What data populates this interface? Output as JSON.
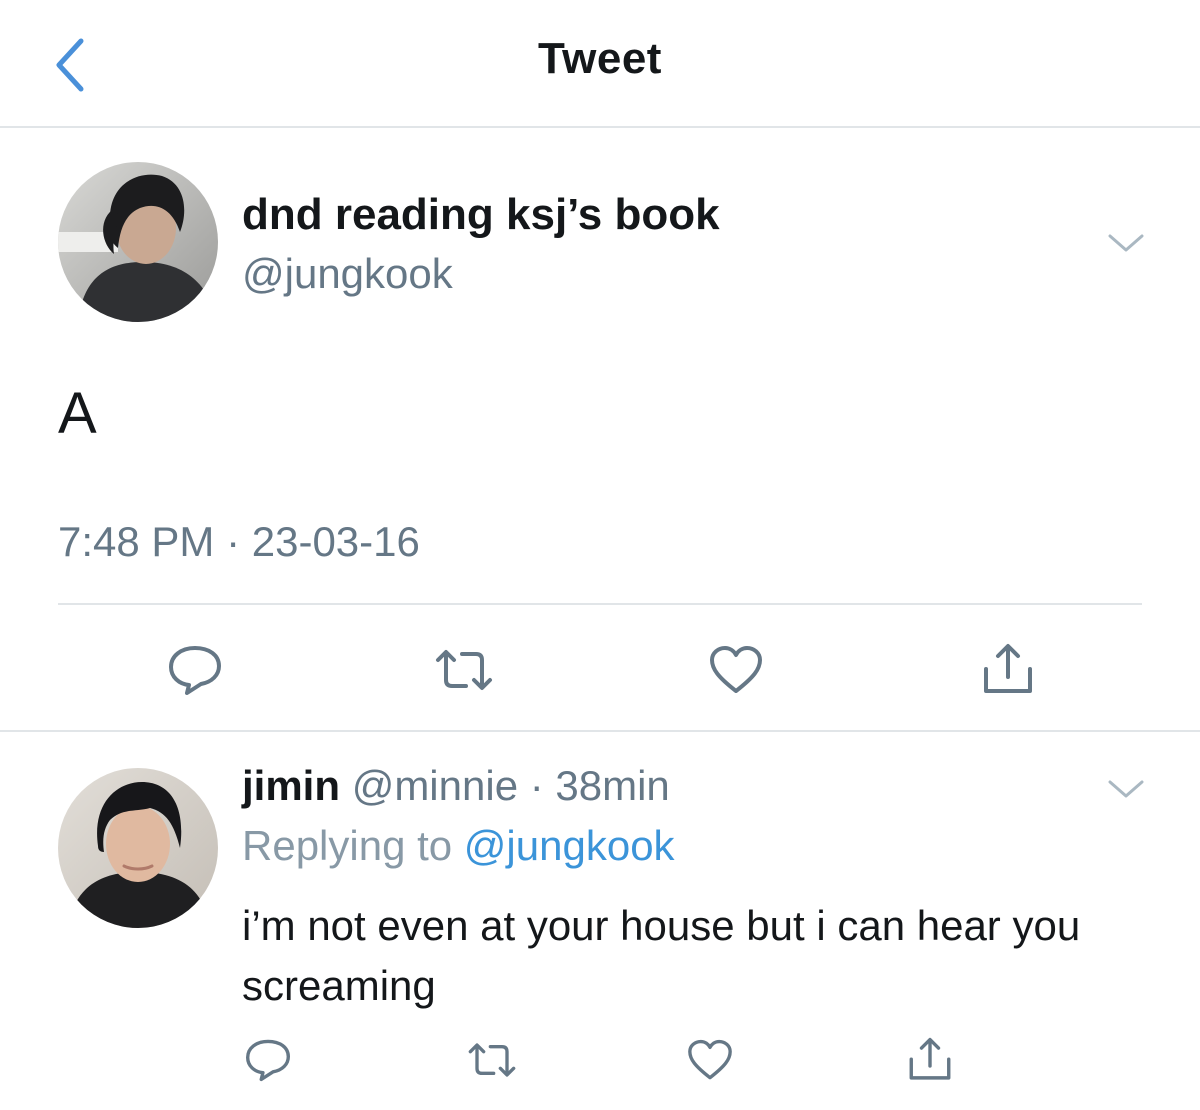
{
  "header": {
    "title": "Tweet"
  },
  "tweet": {
    "display_name": "dnd reading ksj’s book",
    "handle": "@jungkook",
    "text": "A",
    "timestamp": "7:48 PM · 23-03-16"
  },
  "reply": {
    "display_name": "jimin",
    "meta": "@minnie · 38min",
    "replying_prefix": "Replying to ",
    "replying_to": "@jungkook",
    "text": "i’m not even at your house but i can hear you screaming"
  },
  "colors": {
    "accent": "#4a90d9",
    "icon_gray": "#657786",
    "divider": "#e1e5e8",
    "mention": "#3b94d9"
  },
  "icons": [
    "chevron-left-icon",
    "chevron-down-icon",
    "reply-icon",
    "retweet-icon",
    "like-icon",
    "share-icon"
  ]
}
